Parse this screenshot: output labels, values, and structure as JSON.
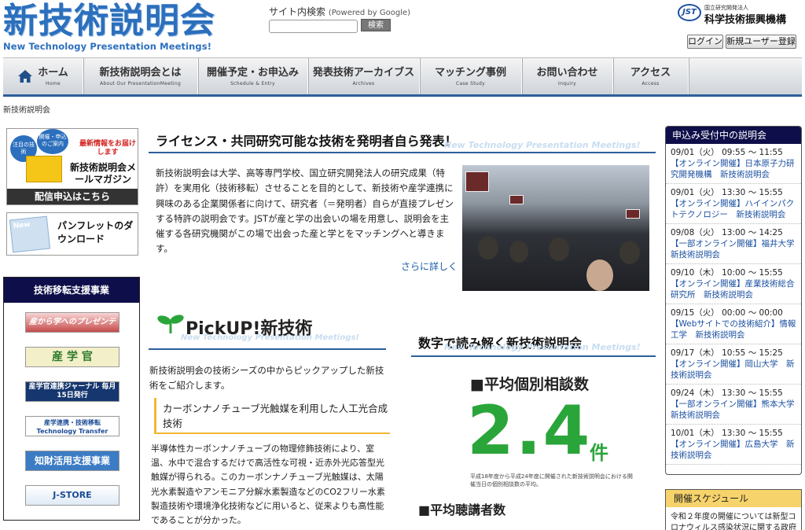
{
  "header": {
    "logo_ja": "新技術説明会",
    "logo_en": "New Technology Presentation Meetings!",
    "search_label": "サイト内検索",
    "search_powered": "(Powered by Google)",
    "search_button": "検索",
    "jst_mark": "JST",
    "jst_line1": "国立研究開発法人",
    "jst_line2": "科学技術振興機構",
    "login": "ログイン",
    "register": "新規ユーザー登録"
  },
  "nav": [
    {
      "ja": "ホーム",
      "en": "Home",
      "icon": "home-icon"
    },
    {
      "ja": "新技術説明会とは",
      "en": "About Our PresentationMeeting"
    },
    {
      "ja": "開催予定・お申込み",
      "en": "Schedule & Entry"
    },
    {
      "ja": "発表技術アーカイブス",
      "en": "Archives"
    },
    {
      "ja": "マッチング事例",
      "en": "Case Study"
    },
    {
      "ja": "お問い合わせ",
      "en": "Inquiry"
    },
    {
      "ja": "アクセス",
      "en": "Access"
    }
  ],
  "breadcrumb": "新技術説明会",
  "left": {
    "mailmag": {
      "badge1": "注目の技術",
      "badge2": "開催・申込のご案内",
      "red": "最新情報をお届けします",
      "title": "新技術説明会メールマガジン",
      "foot": "配信申込はこちら"
    },
    "pamphlet": {
      "doc": "New",
      "title": "パンフレットのダウンロード"
    },
    "support": {
      "title": "技術移転支援事業",
      "banners": [
        "産から学へのプレゼンテーション",
        "産 学 官",
        "産学官連携ジャーナル 毎月15日発行",
        "産学連携・技術移転 Technology Transfer",
        "知財活用支援事業",
        "J-STORE"
      ]
    }
  },
  "lead": {
    "title": "ライセンス・共同研究可能な技術を発明者自ら発表！",
    "en": "New Technology Presentation Meetings!",
    "text": "新技術説明会は大学、高等専門学校、国立研究開発法人の研究成果（特許）を実用化（技術移転）させることを目的として、新技術や産学連携に興味のある企業関係者に向けて、研究者（＝発明者）自らが直接プレゼンする特許の説明会です。JSTが産と学の出会いの場を用意し、説明会を主催する各研究機関がこの場で出会った産と学とをマッチングへと導きます。",
    "more": "さらに詳しく"
  },
  "pickup": {
    "logo": "PickUP!新技術",
    "en": "New Technology Presentation Meetings!",
    "intro": "新技術説明会の技術シーズの中からピックアップした新技術をご紹介します。",
    "head": "カーボンナノチューブ光触媒を利用した人工光合成技術",
    "body": "半導体性カーボンナノチューブの物理修飾技術により、室温、水中で混合するだけで高活性な可視・近赤外光応答型光触媒が得られる。このカーボンナノチューブ光触媒は、太陽光水素製造やアンモニア分解水素製造などのCO2フリー水素製造技術や環境浄化技術などに用いると、従来よりも高性能であることが分かった。"
  },
  "numbers": {
    "title": "数字で読み解く新技術説明会",
    "en": "New Technology Presentation Meetings!",
    "stat1_label": "■平均個別相談数",
    "stat1_value": "2.4",
    "stat1_unit": "件",
    "stat1_note": "平成18年度から平成24年度に開催された新技術説明会における開催当日の個別相談数の平均。",
    "stat2_label": "■平均聴講者数"
  },
  "schedule": {
    "title": "申込み受付中の説明会",
    "events": [
      {
        "date": "09/01（火） 09:55 ～ 11:55",
        "title": "【オンライン開催】日本原子力研究開発機構　新技術説明会"
      },
      {
        "date": "09/01（火） 13:30 ～ 15:55",
        "title": "【オンライン開催】ハイインパクトテクノロジー　新技術説明会"
      },
      {
        "date": "09/08（火） 13:00 ～ 14:25",
        "title": "【一部オンライン開催】福井大学　新技術説明会"
      },
      {
        "date": "09/10（木） 10:00 ～ 15:55",
        "title": "【オンライン開催】産業技術総合研究所　新技術説明会"
      },
      {
        "date": "09/15（火） 00:00 ～ 00:00",
        "title": "【Webサイトでの技術紹介】情報工学　新技術説明会"
      },
      {
        "date": "09/17（木） 10:55 ～ 15:25",
        "title": "【オンライン開催】岡山大学　新技術説明会"
      },
      {
        "date": "09/24（木） 13:30 ～ 15:55",
        "title": "【一部オンライン開催】熊本大学　新技術説明会"
      },
      {
        "date": "10/01（木） 13:30 ～ 15:55",
        "title": "【オンライン開催】広島大学　新技術説明会"
      }
    ]
  },
  "plan": {
    "title": "開催スケジュール",
    "text": "令和２年度の開催については新型コロナウィルス感染状況に関する政府"
  }
}
